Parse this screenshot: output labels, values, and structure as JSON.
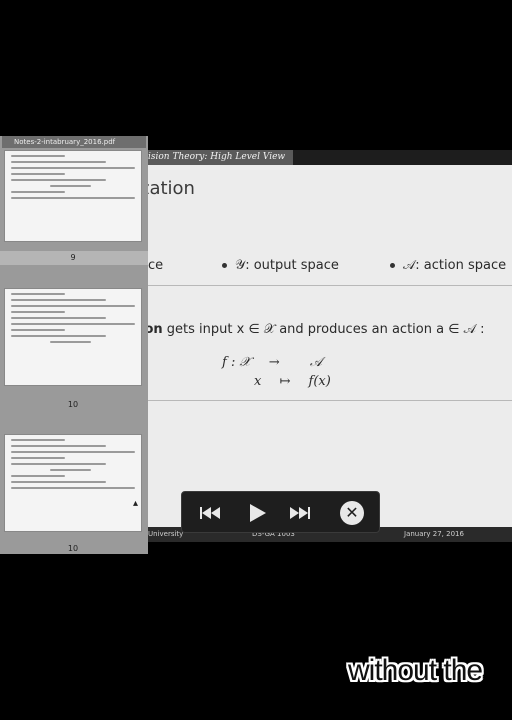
{
  "slide": {
    "header_label": "ision Theory: High Level View",
    "title": "zation",
    "spaces": {
      "left_partial": "ace",
      "output_space": "𝒴: output space",
      "action_space": "𝒜: action space"
    },
    "sentence": {
      "bold_part": "ion",
      "rest": "gets input x ∈ 𝒳 and produces an action a ∈ 𝒜 :"
    },
    "mapping": {
      "row1": {
        "lhs": "f :  𝒳",
        "arrow": "→",
        "rhs": "𝒜"
      },
      "row2": {
        "lhs": "x",
        "arrow": "↦",
        "rhs": "f(x)"
      }
    },
    "footer": {
      "left": "University",
      "center": "DS-GA 1003",
      "right": "January 27, 2016"
    }
  },
  "sidebar": {
    "title": "Notes-2-intabruary_2016.pdf",
    "page_numbers": [
      "9",
      "10",
      "10"
    ]
  },
  "media_controls": {
    "prev_icon": "skip-back-icon",
    "play_icon": "play-icon",
    "next_icon": "skip-forward-icon",
    "close_icon": "close-icon"
  },
  "caption": "without the"
}
